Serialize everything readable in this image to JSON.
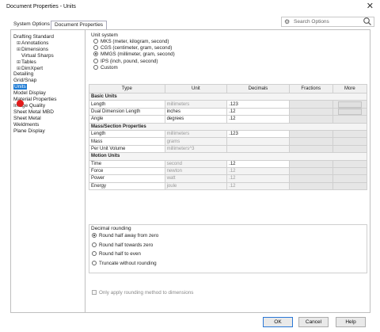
{
  "window": {
    "title": "Document Properties - Units",
    "close_icon": "close-icon"
  },
  "tabs": [
    {
      "label": "System Options"
    },
    {
      "label": "Document Properties"
    }
  ],
  "search": {
    "placeholder": "Search Options",
    "gear_icon": "gear-icon",
    "search_icon": "search-icon"
  },
  "tree": {
    "items": [
      {
        "label": "Drafting Standard",
        "indent": 0,
        "expander": ""
      },
      {
        "label": "Annotations",
        "indent": 1,
        "expander": "+"
      },
      {
        "label": "Dimensions",
        "indent": 1,
        "expander": "+"
      },
      {
        "label": "Virtual Sharps",
        "indent": 1,
        "expander": ""
      },
      {
        "label": "Tables",
        "indent": 1,
        "expander": "+"
      },
      {
        "label": "DimXpert",
        "indent": 1,
        "expander": "+"
      },
      {
        "label": "Detailing",
        "indent": 0,
        "expander": ""
      },
      {
        "label": "Grid/Snap",
        "indent": 0,
        "expander": ""
      },
      {
        "label": "Units",
        "indent": 0,
        "expander": "",
        "selected": true
      },
      {
        "label": "Model Display",
        "indent": 0,
        "expander": ""
      },
      {
        "label": "Material Properties",
        "indent": 0,
        "expander": ""
      },
      {
        "label": "Image Quality",
        "indent": 0,
        "expander": ""
      },
      {
        "label": "Sheet Metal MBD",
        "indent": 0,
        "expander": ""
      },
      {
        "label": "Sheet Metal",
        "indent": 0,
        "expander": ""
      },
      {
        "label": "Weldments",
        "indent": 0,
        "expander": ""
      },
      {
        "label": "Plane Display",
        "indent": 0,
        "expander": ""
      }
    ]
  },
  "unit_system": {
    "title": "Unit system",
    "options": [
      {
        "label": "MKS  (meter, kilogram, second)",
        "checked": false
      },
      {
        "label": "CGS  (centimeter, gram, second)",
        "checked": false
      },
      {
        "label": "MMGS (millimeter, gram, second)",
        "checked": true
      },
      {
        "label": "IPS  (inch, pound, second)",
        "checked": false
      },
      {
        "label": "Custom",
        "checked": false
      }
    ]
  },
  "table": {
    "headers": [
      "Type",
      "Unit",
      "Decimals",
      "Fractions",
      "More"
    ],
    "rows": [
      {
        "kind": "section",
        "type": "Basic Units"
      },
      {
        "kind": "row",
        "type": "Length",
        "unit": "millimeters",
        "decimals": ".123",
        "unit_enabled": false,
        "dec_enabled": true,
        "more": true
      },
      {
        "kind": "row",
        "type": "Dual Dimension Length",
        "unit": "inches",
        "decimals": ".12",
        "unit_enabled": true,
        "dec_enabled": true,
        "more": true
      },
      {
        "kind": "row",
        "type": "Angle",
        "unit": "degrees",
        "decimals": ".12",
        "unit_enabled": true,
        "dec_enabled": true,
        "more": false
      },
      {
        "kind": "section",
        "type": "Mass/Section Properties"
      },
      {
        "kind": "row",
        "type": "Length",
        "unit": "millimeters",
        "decimals": ".123",
        "unit_enabled": false,
        "dec_enabled": true,
        "more": false
      },
      {
        "kind": "row",
        "type": "Mass",
        "unit": "grams",
        "decimals": "",
        "unit_enabled": false,
        "dec_enabled": false,
        "more": false
      },
      {
        "kind": "row",
        "type": "Per Unit Volume",
        "unit": "millimeters^3",
        "decimals": "",
        "unit_enabled": false,
        "dec_enabled": false,
        "more": false
      },
      {
        "kind": "section",
        "type": "Motion Units"
      },
      {
        "kind": "row",
        "type": "Time",
        "unit": "second",
        "decimals": ".12",
        "unit_enabled": false,
        "dec_enabled": true,
        "more": false
      },
      {
        "kind": "row",
        "type": "Force",
        "unit": "newton",
        "decimals": ".12",
        "unit_enabled": false,
        "dec_enabled": false,
        "more": false
      },
      {
        "kind": "row",
        "type": "Power",
        "unit": "watt",
        "decimals": ".12",
        "unit_enabled": false,
        "dec_enabled": false,
        "more": false
      },
      {
        "kind": "row",
        "type": "Energy",
        "unit": "joule",
        "decimals": ".12",
        "unit_enabled": false,
        "dec_enabled": false,
        "more": false
      }
    ]
  },
  "rounding": {
    "title": "Decimal rounding",
    "options": [
      {
        "label": "Round half away from zero",
        "checked": true
      },
      {
        "label": "Round half towards zero",
        "checked": false
      },
      {
        "label": "Round half to even",
        "checked": false
      },
      {
        "label": "Truncate without rounding",
        "checked": false
      }
    ]
  },
  "apply_rounding": {
    "label": "Only apply rounding method to dimensions",
    "checked": false
  },
  "buttons": {
    "ok": "OK",
    "cancel": "Cancel",
    "help": "Help"
  },
  "colors": {
    "selection": "#1e7bd4",
    "cursor": "#e21b1b"
  }
}
